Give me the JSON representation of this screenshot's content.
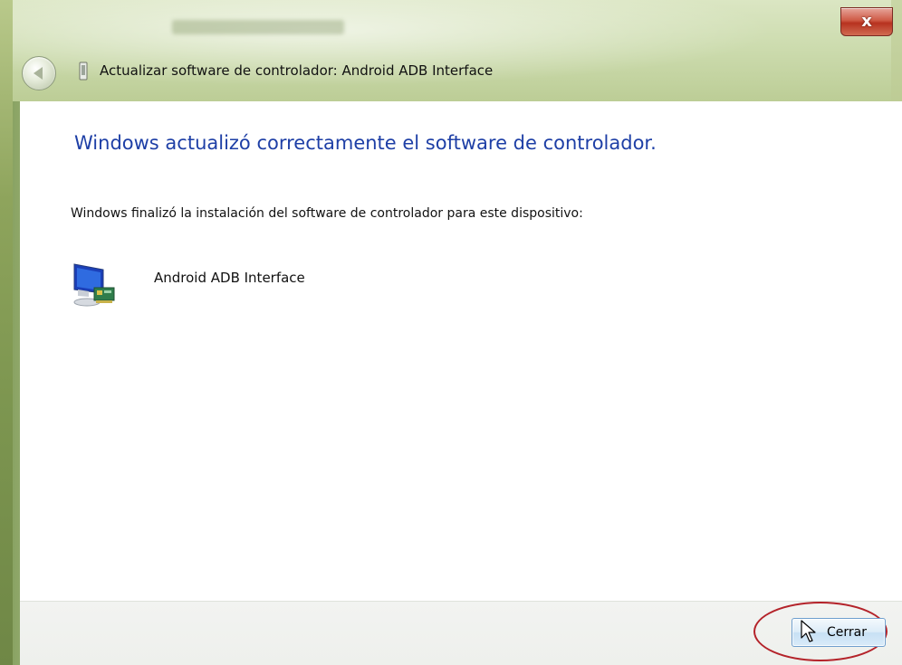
{
  "window": {
    "close_glyph": "x",
    "title": "Actualizar software de controlador: Android ADB Interface"
  },
  "content": {
    "heading": "Windows actualizó correctamente el software de controlador.",
    "description": "Windows finalizó la instalación del software de controlador para este dispositivo:",
    "device_name": "Android ADB Interface"
  },
  "footer": {
    "close_label": "Cerrar"
  },
  "colors": {
    "heading": "#1e3fa6",
    "highlight": "#b4232a",
    "close_button_red": "#cf5a45"
  },
  "icons": {
    "back": "back-arrow-icon",
    "device_small": "device-manager-icon",
    "device": "monitor-network-card-icon",
    "cursor": "mouse-cursor-icon"
  }
}
